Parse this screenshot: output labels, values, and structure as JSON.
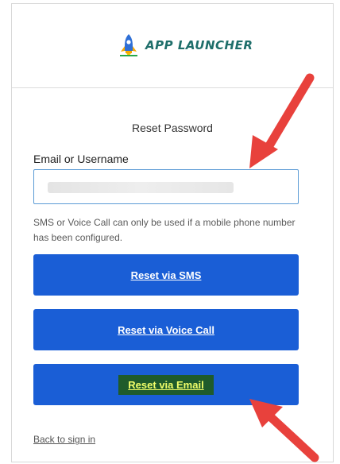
{
  "brand": {
    "name": "APP LAUNCHER",
    "icon": "rocket-icon",
    "colors": {
      "text": "#1e6e6a",
      "rocket_body": "#2f6fd6",
      "rocket_fins": "#f6a800"
    }
  },
  "form": {
    "title": "Reset Password",
    "email_label": "Email or Username",
    "email_value": "",
    "hint": "SMS or Voice Call can only be used if a mobile phone number has been configured."
  },
  "buttons": {
    "sms": "Reset via SMS",
    "voice": "Reset via Voice Call",
    "email": "Reset via Email"
  },
  "links": {
    "back": "Back to sign in"
  },
  "annotations": {
    "arrow_color": "#e8413c",
    "highlight_bg": "#1f5b2b",
    "highlight_text": "#f2ff6a"
  },
  "colors": {
    "primary_button": "#1a5ed6",
    "input_border": "#5b9bd5"
  }
}
